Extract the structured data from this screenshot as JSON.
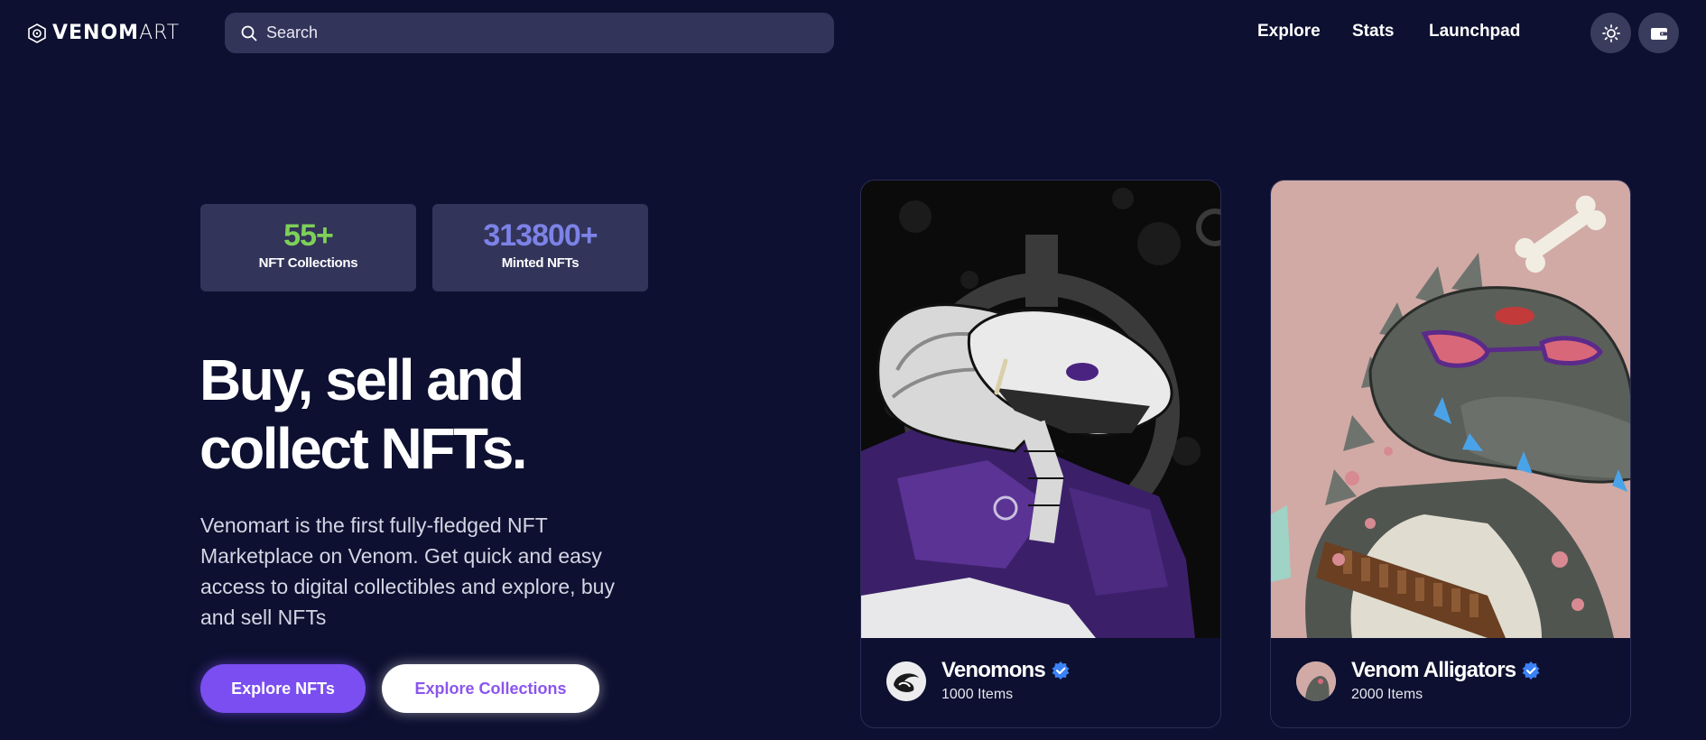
{
  "header": {
    "logo_bold": "VENOM",
    "logo_light": "ART",
    "search_placeholder": "Search",
    "nav": [
      "Explore",
      "Stats",
      "Launchpad"
    ]
  },
  "stats": [
    {
      "value": "55+",
      "label": "NFT Collections",
      "color": "#7ed058"
    },
    {
      "value": "313800+",
      "label": "Minted NFTs",
      "color": "#7c82e6"
    }
  ],
  "hero": {
    "title_line1": "Buy, sell and",
    "title_line2": "collect NFTs.",
    "description": "Venomart is the first fully-fledged NFT Marketplace on Venom. Get quick and easy access to digital collectibles and explore, buy and sell NFTs",
    "primary_button": "Explore NFTs",
    "secondary_button": "Explore Collections"
  },
  "collections": [
    {
      "name": "Venomons",
      "items": "1000 Items",
      "verified": true,
      "art": "white cobra in purple hoodie"
    },
    {
      "name": "Venom Alligators",
      "items": "2000 Items",
      "verified": true,
      "art": "grey alligator with sunglasses"
    }
  ],
  "colors": {
    "background": "#0d1030",
    "accent": "#7a4ef0",
    "card": "#32345a",
    "verified": "#3b82f6"
  }
}
